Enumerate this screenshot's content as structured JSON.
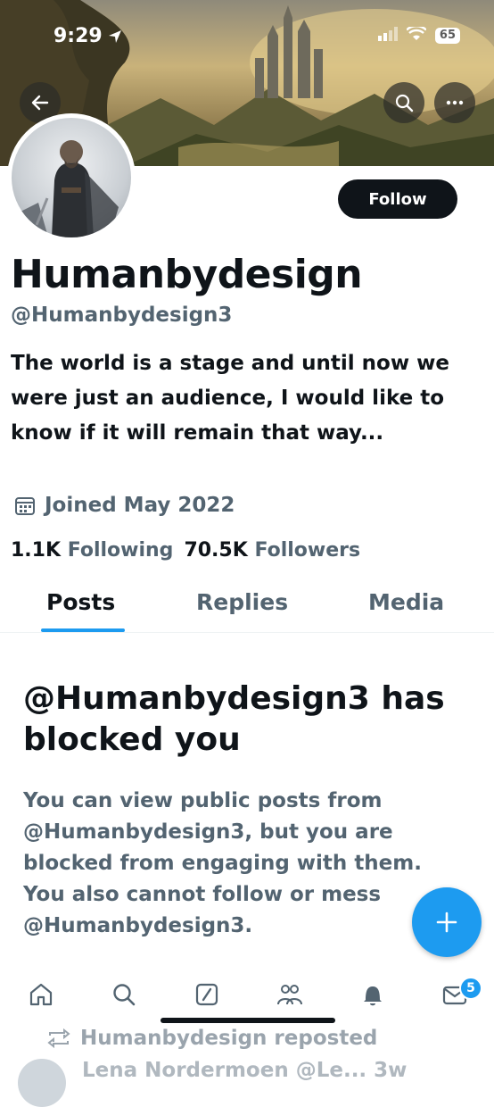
{
  "status_bar": {
    "time": "9:29",
    "battery": "65"
  },
  "profile": {
    "display_name": "Humanbydesign",
    "handle": "@Humanbydesign3",
    "bio": "The world is a stage and until now we were just an audience, I would like to know if it will remain that way...",
    "joined": "Joined May 2022",
    "following_count": "1.1K",
    "following_label": "Following",
    "followers_count": "70.5K",
    "followers_label": "Followers"
  },
  "actions": {
    "follow_label": "Follow"
  },
  "tabs": [
    {
      "label": "Posts",
      "active": true
    },
    {
      "label": "Replies",
      "active": false
    },
    {
      "label": "Media",
      "active": false
    }
  ],
  "blocked": {
    "title": "@Humanbydesign3 has blocked you",
    "body": "You can view public posts from @Humanbydesign3, but you are blocked from engaging with them. You also cannot follow or mess @Humanbydesign3."
  },
  "fab": {
    "icon": "plus-icon"
  },
  "bottom_nav": {
    "items": [
      "home-icon",
      "search-icon",
      "grok-icon",
      "communities-icon",
      "notifications-icon",
      "messages-icon"
    ],
    "messages_badge": "5"
  },
  "feed_preview": {
    "repost_text": "Humanbydesign reposted",
    "next_author": "Lena Nordermoen @Le... 3w"
  },
  "colors": {
    "accent": "#1d9bf0",
    "text": "#0f1419",
    "muted": "#536471"
  }
}
